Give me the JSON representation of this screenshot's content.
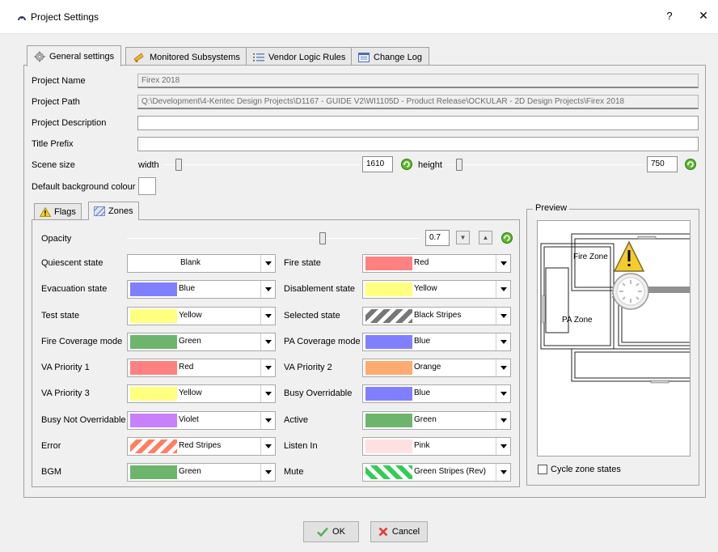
{
  "window": {
    "title": "Project Settings",
    "help": "?",
    "close": "✕"
  },
  "tabs": [
    {
      "label": "General settings",
      "icon": "gear-icon"
    },
    {
      "label": "Monitored Subsystems",
      "icon": "bell-icon"
    },
    {
      "label": "Vendor Logic Rules",
      "icon": "list-icon"
    },
    {
      "label": "Change Log",
      "icon": "log-icon"
    }
  ],
  "general": {
    "project_name_label": "Project Name",
    "project_name_value": "Firex 2018",
    "project_path_label": "Project Path",
    "project_path_value": "Q:\\Development\\4-Kentec Design Projects\\D1167 - GUIDE V2\\WI1105D - Product Release\\OCKULAR - 2D Design Projects\\Firex 2018",
    "project_description_label": "Project Description",
    "project_description_value": "",
    "title_prefix_label": "Title Prefix",
    "title_prefix_value": "",
    "scene_size_label": "Scene size",
    "width_label": "width",
    "width_value": "1610",
    "height_label": "height",
    "height_value": "750",
    "background_label": "Default background colour",
    "background_color": "#ffffff"
  },
  "inner_tabs": [
    {
      "label": "Flags",
      "icon": "warning-icon"
    },
    {
      "label": "Zones",
      "icon": "hatch-icon"
    }
  ],
  "zones": {
    "opacity_label": "Opacity",
    "opacity_value": "0.7",
    "left": [
      {
        "label": "Quiescent state",
        "value": "Blank",
        "color": "none",
        "pattern": "blank"
      },
      {
        "label": "Evacuation state",
        "value": "Blue",
        "color": "#8080ff",
        "pattern": "solid"
      },
      {
        "label": "Test state",
        "value": "Yellow",
        "color": "#ffff80",
        "pattern": "solid"
      },
      {
        "label": "Fire Coverage mode",
        "value": "Green",
        "color": "#6db56d",
        "pattern": "solid"
      },
      {
        "label": "VA Priority 1",
        "value": "Red",
        "color": "#ff8080",
        "pattern": "solid"
      },
      {
        "label": "VA Priority 3",
        "value": "Yellow",
        "color": "#ffff80",
        "pattern": "solid"
      },
      {
        "label": "Busy Not Overridable",
        "value": "Violet",
        "color": "#c880ff",
        "pattern": "solid"
      },
      {
        "label": "Error",
        "value": "Red Stripes",
        "color": "#ff8060",
        "pattern": "stripes"
      },
      {
        "label": "BGM",
        "value": "Green",
        "color": "#6db56d",
        "pattern": "solid"
      }
    ],
    "right": [
      {
        "label": "Fire state",
        "value": "Red",
        "color": "#ff8080",
        "pattern": "solid"
      },
      {
        "label": "Disablement state",
        "value": "Yellow",
        "color": "#ffff80",
        "pattern": "solid"
      },
      {
        "label": "Selected state",
        "value": "Black Stripes",
        "color": "#777777",
        "pattern": "stripes"
      },
      {
        "label": "PA Coverage mode",
        "value": "Blue",
        "color": "#8080ff",
        "pattern": "solid"
      },
      {
        "label": "VA Priority 2",
        "value": "Orange",
        "color": "#ffaa70",
        "pattern": "solid"
      },
      {
        "label": "Busy Overridable",
        "value": "Blue",
        "color": "#8080ff",
        "pattern": "solid"
      },
      {
        "label": "Active",
        "value": "Green",
        "color": "#6db56d",
        "pattern": "solid"
      },
      {
        "label": "Listen In",
        "value": "Pink",
        "color": "#ffe0e0",
        "pattern": "solid"
      },
      {
        "label": "Mute",
        "value": "Green Stripes (Rev)",
        "color": "#33cc55",
        "pattern": "stripes-rev"
      }
    ]
  },
  "preview": {
    "legend": "Preview",
    "zone_fire": "Fire Zone",
    "zone_pa": "PA Zone",
    "cycle_label": "Cycle zone states",
    "cycle_checked": false
  },
  "buttons": {
    "ok": "OK",
    "cancel": "Cancel"
  }
}
